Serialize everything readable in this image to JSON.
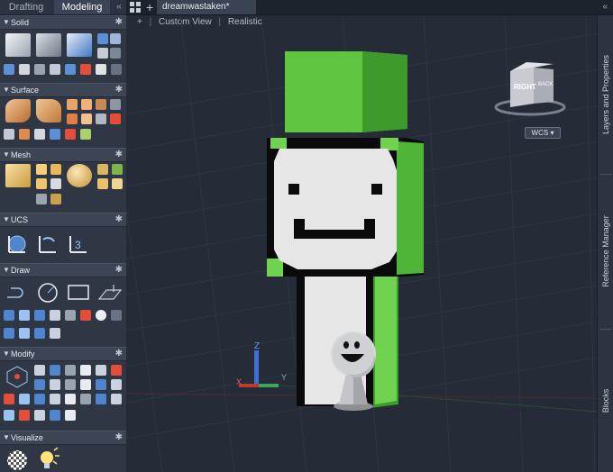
{
  "workspace_tabs": [
    {
      "label": "Drafting",
      "active": false
    },
    {
      "label": "Modeling",
      "active": true
    }
  ],
  "collapse_glyph": "«",
  "document": {
    "new_tab_glyph": "+",
    "tab_label": "dreamwastaken*"
  },
  "palette": {
    "sections": [
      {
        "title": "Solid"
      },
      {
        "title": "Surface"
      },
      {
        "title": "Mesh"
      },
      {
        "title": "UCS"
      },
      {
        "title": "Draw"
      },
      {
        "title": "Modify"
      },
      {
        "title": "Visualize"
      }
    ]
  },
  "viewport": {
    "controls": {
      "plus": "+",
      "view": "Custom View",
      "style": "Realistic"
    },
    "viewcube": {
      "face1": "RIGHT",
      "face2": "BACK"
    },
    "coord_system": "WCS",
    "axis_labels": {
      "x": "X",
      "y": "Y",
      "z": "Z"
    }
  },
  "right_panels": [
    {
      "label": "Layers and Properties"
    },
    {
      "label": "Reference Manager"
    },
    {
      "label": "Blocks"
    }
  ],
  "colors": {
    "hood_green": "#6fd34f",
    "hood_dark": "#3f9a2c",
    "mask_white": "#e6e6e6",
    "outline": "#0a0a0a",
    "background": "#252c38"
  }
}
